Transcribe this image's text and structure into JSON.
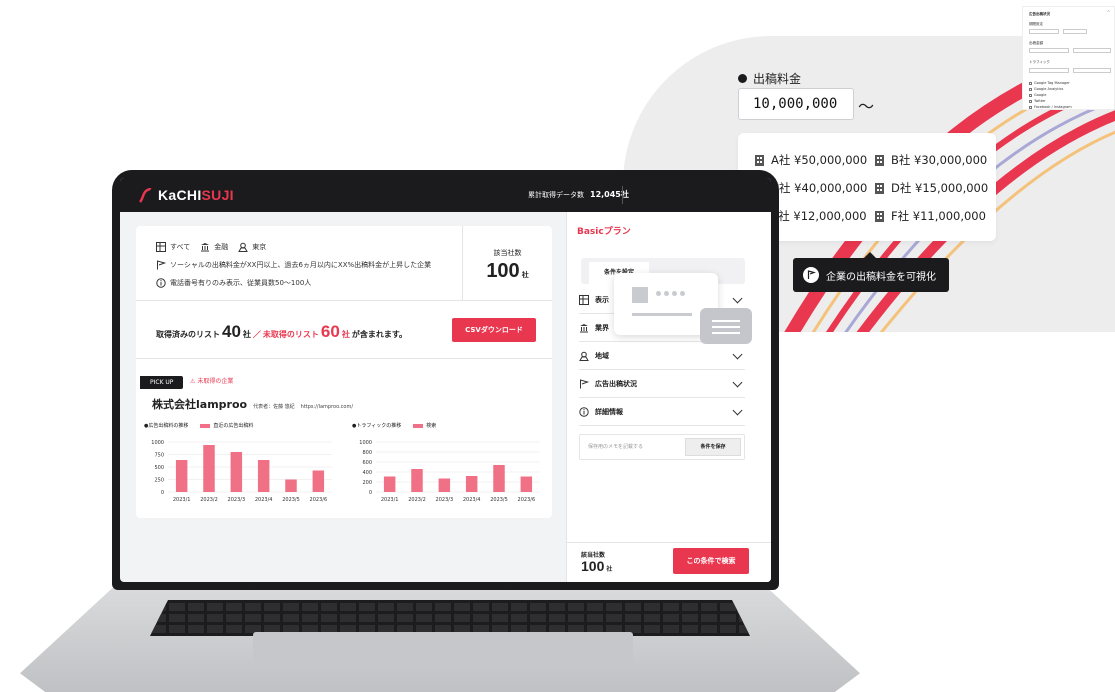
{
  "app": {
    "brand_prefix": "KaCHI",
    "brand_suffix": "SUJI",
    "header_stat_label": "累計取得データ数",
    "header_stat_value": "12,045社"
  },
  "conditions": {
    "scope": "すべて",
    "industry": "金融",
    "region": "東京",
    "ad_condition": "ソーシャルの出稿料金がXX円以上、過去6ヵ月以内にXX%出稿料金が上昇した企業",
    "detail_condition": "電話番号有りのみ表示、従業員数50〜100人"
  },
  "result_count": {
    "label": "該当社数",
    "value": "100",
    "unit": "社"
  },
  "list_summary": {
    "prefix": "取得済みのリスト",
    "acquired": "40",
    "unit1": "社",
    "slash": "／",
    "unacquired_label": "未取得のリスト",
    "unacquired": "60",
    "unit2": "社",
    "suffix": "が含まれます。",
    "csv_button": "CSVダウンロード"
  },
  "pickup": {
    "badge": "PICK UP",
    "warning": "未取得の企業",
    "company_name": "株式会社lamproo",
    "representative": "代表者：佐藤 悠紀",
    "url": "https://lamproo.com/"
  },
  "chart_data": [
    {
      "type": "bar",
      "title": "",
      "legend_title": "●広告出稿料の推移",
      "series": [
        {
          "name": "直近の広告出稿料",
          "values": [
            640,
            940,
            800,
            640,
            250,
            430
          ]
        }
      ],
      "categories": [
        "2023/1",
        "2023/2",
        "2023/3",
        "2023/4",
        "2023/5",
        "2023/6"
      ],
      "yticks": [
        "0",
        "250",
        "500",
        "750",
        "1000"
      ],
      "ylim": [
        0,
        1000
      ]
    },
    {
      "type": "bar",
      "title": "",
      "legend_title": "●トラフィックの推移",
      "series": [
        {
          "name": "検索",
          "values": [
            310,
            460,
            270,
            320,
            540,
            310
          ]
        }
      ],
      "categories": [
        "2023/1",
        "2023/2",
        "2023/3",
        "2023/4",
        "2023/5",
        "2023/6"
      ],
      "yticks": [
        "0",
        "200",
        "400",
        "600",
        "800",
        "1000"
      ],
      "ylim": [
        0,
        1000
      ]
    }
  ],
  "right_panel": {
    "plan_title": "Basicプラン",
    "tab_active": "条件を設定",
    "accordion": [
      "表示",
      "業界",
      "地域",
      "広告出稿状況",
      "詳細情報"
    ],
    "memo_placeholder": "保存用のメモを記載する",
    "save_button": "条件を保存",
    "count_label": "該当社数",
    "count_value": "100",
    "count_unit": "社",
    "search_button": "この条件で検索"
  },
  "bubble": {
    "title": "出稿料金",
    "input_value": "10,000,000",
    "tilde": "〜",
    "companies": [
      "A社 ¥50,000,000",
      "B社 ¥30,000,000",
      "C社 ¥40,000,000",
      "D社 ¥15,000,000",
      "E社 ¥12,000,000",
      "F社 ¥11,000,000"
    ],
    "tooltip": "企業の出稿料金を可視化"
  },
  "mini_panel": {
    "title": "広告出稿状況",
    "labels": [
      "期間設定",
      "出稿金額",
      "トラフィック"
    ],
    "options": [
      "Google Tag Manager",
      "Google Analytics",
      "Google",
      "Twitter",
      "Facebook / Instagram"
    ]
  },
  "colors": {
    "accent": "#e8374f",
    "dark": "#1b1b1d",
    "bar": "#f07086"
  }
}
